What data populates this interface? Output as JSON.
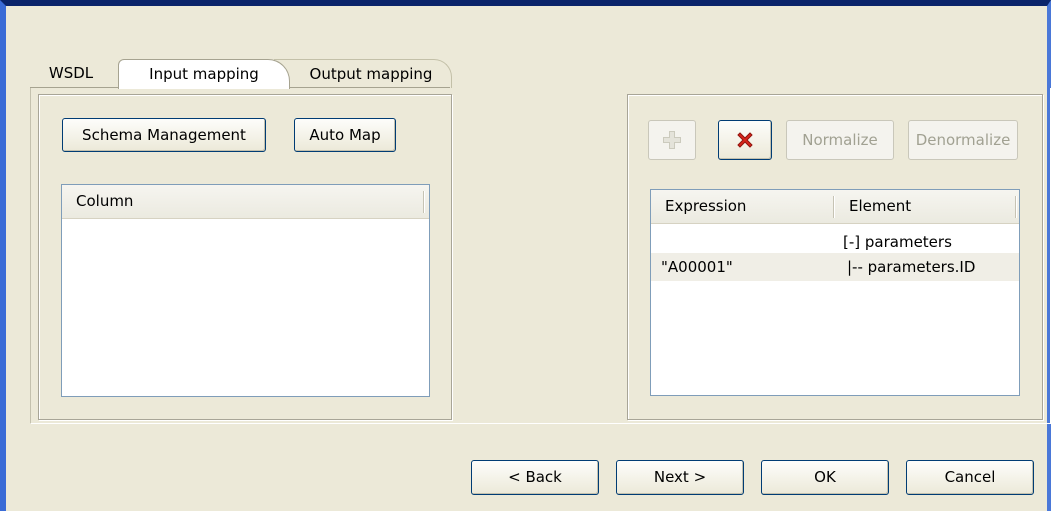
{
  "tabs": [
    {
      "label": "WSDL",
      "active": false
    },
    {
      "label": "Input mapping",
      "active": true
    },
    {
      "label": "Output mapping",
      "active": false
    }
  ],
  "left_panel": {
    "schema_management_label": "Schema Management",
    "auto_map_label": "Auto Map",
    "column_header": "Column"
  },
  "right_panel": {
    "add_icon": "plus-icon",
    "delete_icon": "red-x-icon",
    "normalize_label": "Normalize",
    "denormalize_label": "Denormalize",
    "headers": {
      "expression": "Expression",
      "element": "Element"
    },
    "rows": [
      {
        "expression": "",
        "element": "[-] parameters",
        "highlighted": false
      },
      {
        "expression": "\"A00001\"",
        "element": "|-- parameters.ID",
        "highlighted": true
      }
    ]
  },
  "footer": {
    "back_label": "< Back",
    "next_label": "Next >",
    "ok_label": "OK",
    "cancel_label": "Cancel"
  },
  "colors": {
    "window_bg": "#ece9d8",
    "title_border": "#0a246a",
    "delete_red": "#d9261c",
    "row_highlight": "#f0eee6"
  }
}
